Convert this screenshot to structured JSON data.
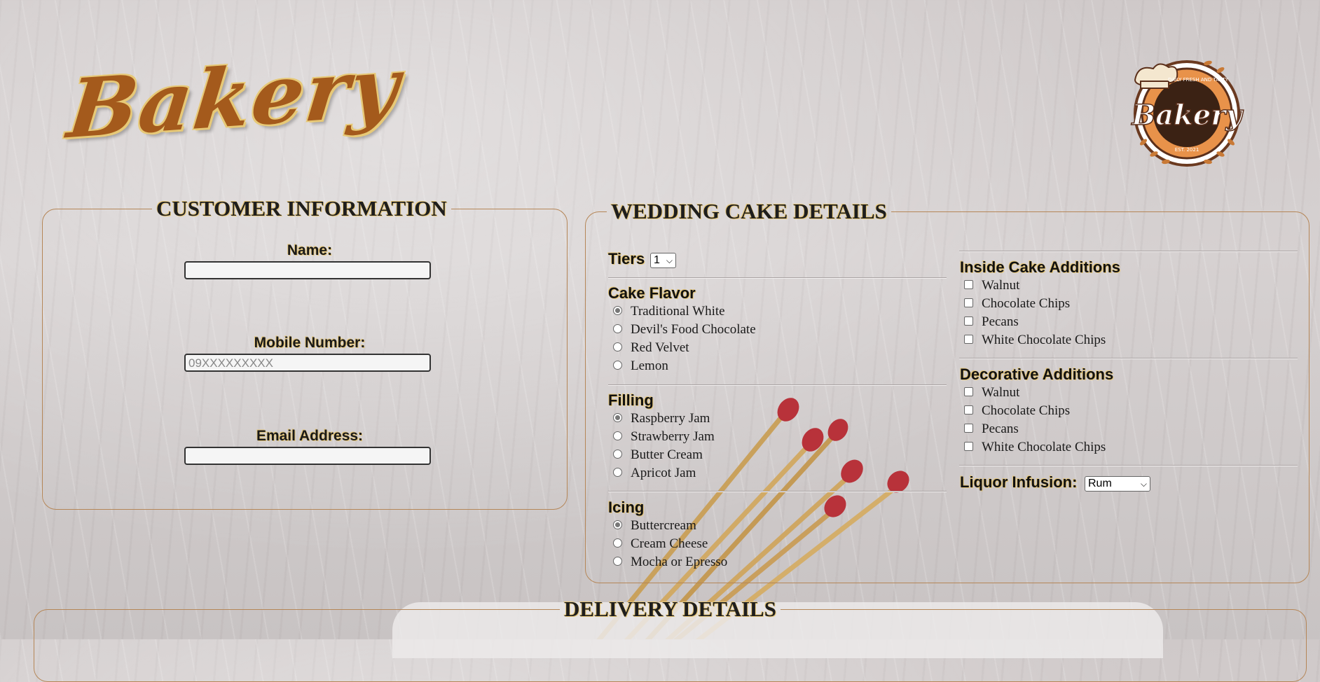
{
  "brand": {
    "title": "Bakery"
  },
  "logo": {
    "name": "Bakery",
    "tagline": "DAILY FRESH AND TASTY",
    "est": "EST. 2021"
  },
  "customer": {
    "legend": "CUSTOMER INFORMATION",
    "name_label": "Name:",
    "name_value": "",
    "mobile_label": "Mobile Number:",
    "mobile_placeholder": "09XXXXXXXXX",
    "email_label": "Email Address:",
    "email_value": ""
  },
  "cake": {
    "legend": "WEDDING CAKE DETAILS",
    "tiers_label": "Tiers",
    "tiers_value": "1",
    "flavor_label": "Cake Flavor",
    "flavors": [
      "Traditional White",
      "Devil's Food Chocolate",
      "Red Velvet",
      "Lemon"
    ],
    "flavor_selected": "Traditional White",
    "filling_label": "Filling",
    "fillings": [
      "Raspberry Jam",
      "Strawberry Jam",
      "Butter Cream",
      "Apricot Jam"
    ],
    "filling_selected": "Raspberry Jam",
    "icing_label": "Icing",
    "icings": [
      "Buttercream",
      "Cream Cheese",
      "Mocha or Epresso"
    ],
    "icing_selected": "Buttercream",
    "inside_label": "Inside Cake Additions",
    "inside": [
      "Walnut",
      "Chocolate Chips",
      "Pecans",
      "White Chocolate Chips"
    ],
    "decorative_label": "Decorative Additions",
    "decorative": [
      "Walnut",
      "Chocolate Chips",
      "Pecans",
      "White Chocolate Chips"
    ],
    "liquor_label": "Liquor Infusion:",
    "liquor_value": "Rum"
  },
  "delivery": {
    "legend": "DELIVERY DETAILS"
  },
  "icons": {
    "tiers_dropdown": "chevron-down-icon",
    "liquor_dropdown": "chevron-down-icon"
  },
  "colors": {
    "brand": "#a45a1c",
    "brand_outline": "#e7c977",
    "panel_border": "#b58657"
  }
}
